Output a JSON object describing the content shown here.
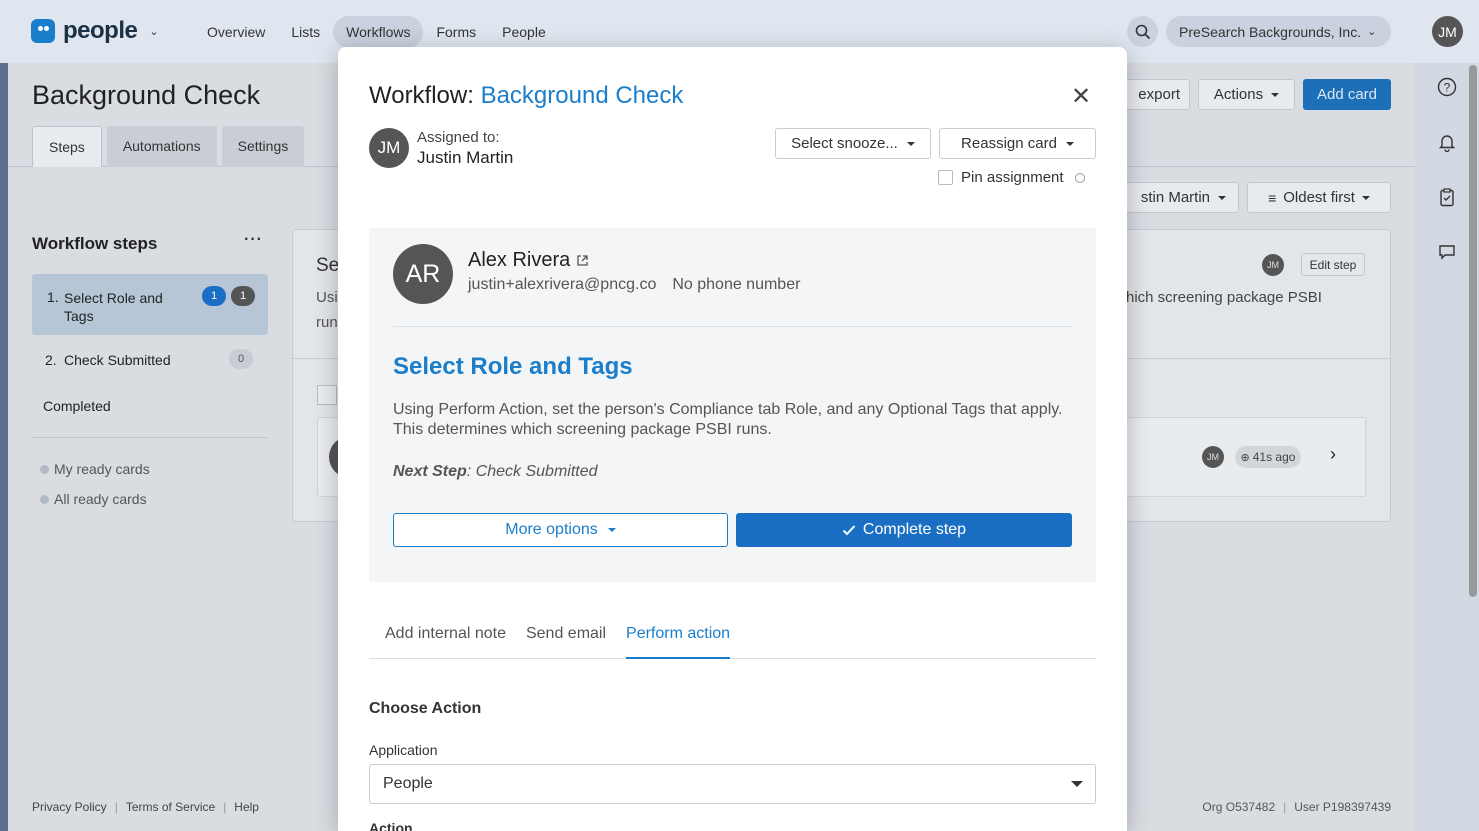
{
  "topnav": {
    "logo_text": "people",
    "links": [
      "Overview",
      "Lists",
      "Workflows",
      "Forms",
      "People"
    ],
    "active_link": "Workflows",
    "org_name": "PreSearch Backgrounds, Inc.",
    "user_initials": "JM"
  },
  "background": {
    "title": "Background Check",
    "tabs": [
      "Steps",
      "Automations",
      "Settings"
    ],
    "export_label": "export",
    "actions_label": "Actions",
    "add_card_label": "Add card",
    "assignee_filter": "stin Martin",
    "sort_label": "Oldest first",
    "workflow_steps_title": "Workflow steps",
    "steps": [
      {
        "number": "1.",
        "label": "Select Role and Tags",
        "badge_a": "1",
        "badge_b": "1"
      },
      {
        "number": "2.",
        "label": "Check Submitted",
        "badge_b": "0"
      },
      {
        "number": "",
        "label": "Completed"
      }
    ],
    "ready_links": [
      "My ready cards",
      "All ready cards"
    ],
    "card_text_fragment": "hich screening package PSBI",
    "peek_a": "Se",
    "peek_b": "Usi",
    "peek_c": "run",
    "card_initials": "JM",
    "edit_step_label": "Edit step",
    "time_ago": "41s ago",
    "footer_left": [
      "Privacy Policy",
      "Terms of Service",
      "Help"
    ],
    "footer_right": [
      "Org O537482",
      "User P198397439"
    ]
  },
  "modal": {
    "title_prefix": "Workflow: ",
    "title_accent": "Background Check",
    "assignee_initials": "JM",
    "assigned_to_label": "Assigned to:",
    "assignee_name": "Justin Martin",
    "snooze_label": "Select snooze...",
    "reassign_label": "Reassign card",
    "pin_label": "Pin assignment",
    "person": {
      "initials": "AR",
      "name": "Alex Rivera",
      "email": "justin+alexrivera@pncg.co",
      "phone": "No phone number"
    },
    "step_title": "Select Role and Tags",
    "step_description": "Using Perform Action, set the person's Compliance tab Role, and any Optional Tags that apply. This determines which screening package PSBI runs.",
    "next_step_label": "Next Step",
    "next_step_value": ": Check Submitted",
    "more_options_label": "More options",
    "complete_label": "Complete step",
    "tabs": [
      "Add internal note",
      "Send email",
      "Perform action"
    ],
    "active_tab": "Perform action",
    "choose_action_title": "Choose Action",
    "application_label": "Application",
    "application_value": "People",
    "action_label": "Action"
  },
  "colors": {
    "accent": "#1a7ecb",
    "primary_button": "#1a6fc4",
    "avatar": "#555555"
  }
}
